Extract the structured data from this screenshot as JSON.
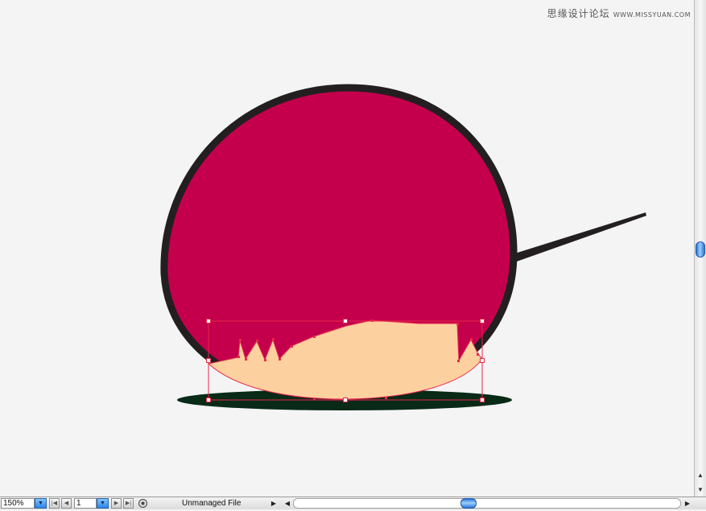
{
  "watermark": {
    "text_cn": "思缘设计论坛",
    "url": "WWW.MISSYUAN.COM"
  },
  "status_bar": {
    "zoom_value": "150%",
    "page_value": "1",
    "status_text": "Unmanaged File"
  },
  "icons": {
    "zoom_dropdown": "chevron-down-icon",
    "page_dropdown": "chevron-down-icon",
    "first_page": "first-page-icon",
    "prev_page": "previous-page-icon",
    "next_page": "next-page-icon",
    "last_page": "last-page-icon",
    "status_menu": "play-triangle-icon",
    "scroll_left": "scroll-left-icon",
    "scroll_right": "scroll-right-icon",
    "scroll_up": "scroll-up-icon",
    "scroll_down": "scroll-down-icon"
  },
  "colors": {
    "canvas_bg": "#f4f4f4",
    "body_fill": "#c4004d",
    "outline": "#231f20",
    "face_fill": "#fdd09f",
    "shadow": "#082a17",
    "selection": "#e6294b",
    "scroll_thumb": "#3b8be8"
  }
}
